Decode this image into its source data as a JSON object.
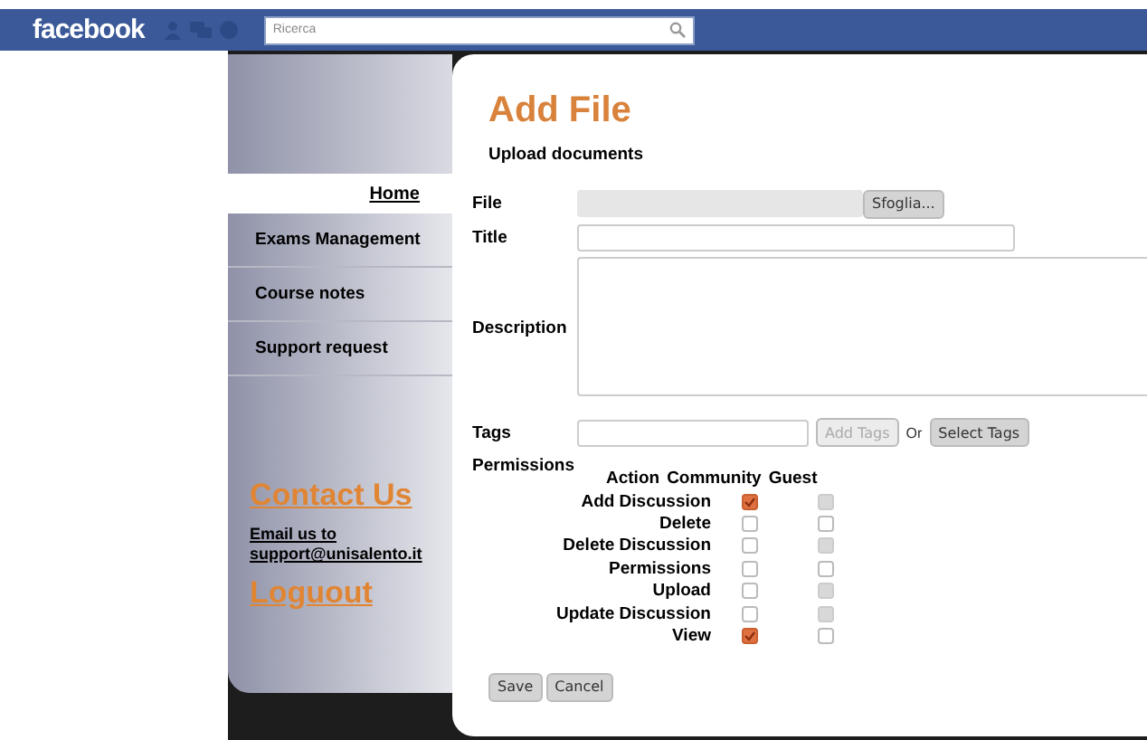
{
  "topbar": {
    "logo": "facebook",
    "search": {
      "placeholder": "Ricerca"
    }
  },
  "sidebar": {
    "home": "Home",
    "items": [
      "Exams Management",
      "Course notes",
      "Support request"
    ],
    "contact": {
      "heading": "Contact Us",
      "email": "Email us to support@unisalento.it",
      "logout": "Loguout"
    }
  },
  "dialog": {
    "title": "Add File",
    "subtitle": "Upload documents",
    "file": {
      "label": "File",
      "button": "Sfoglia..."
    },
    "title_field": {
      "label": "Title"
    },
    "description": {
      "label": "Description"
    },
    "tags": {
      "label": "Tags",
      "add_button": {
        "label": "Add Tags",
        "disabled": true
      },
      "or": "Or",
      "select_button": {
        "label": "Select Tags",
        "disabled": false
      }
    },
    "permissions": {
      "label": "Permissions",
      "columns": [
        "Action",
        "Community",
        "Guest"
      ],
      "rows": [
        {
          "action": "Add Discussion",
          "community": {
            "checked": true
          },
          "guest": {
            "checked": false,
            "disabled": true
          }
        },
        {
          "action": "Delete",
          "community": {
            "checked": false
          },
          "guest": {
            "checked": false,
            "disabled": false
          }
        },
        {
          "action": "Delete Discussion",
          "community": {
            "checked": false
          },
          "guest": {
            "checked": false,
            "disabled": true
          }
        },
        {
          "action": "Permissions",
          "community": {
            "checked": false
          },
          "guest": {
            "checked": false,
            "disabled": false
          }
        },
        {
          "action": "Upload",
          "community": {
            "checked": false
          },
          "guest": {
            "checked": false,
            "disabled": true
          }
        },
        {
          "action": "Update Discussion",
          "community": {
            "checked": false
          },
          "guest": {
            "checked": false,
            "disabled": true
          }
        },
        {
          "action": "View",
          "community": {
            "checked": true
          },
          "guest": {
            "checked": false,
            "disabled": false
          }
        }
      ]
    },
    "buttons": [
      "Save",
      "Cancel"
    ]
  }
}
